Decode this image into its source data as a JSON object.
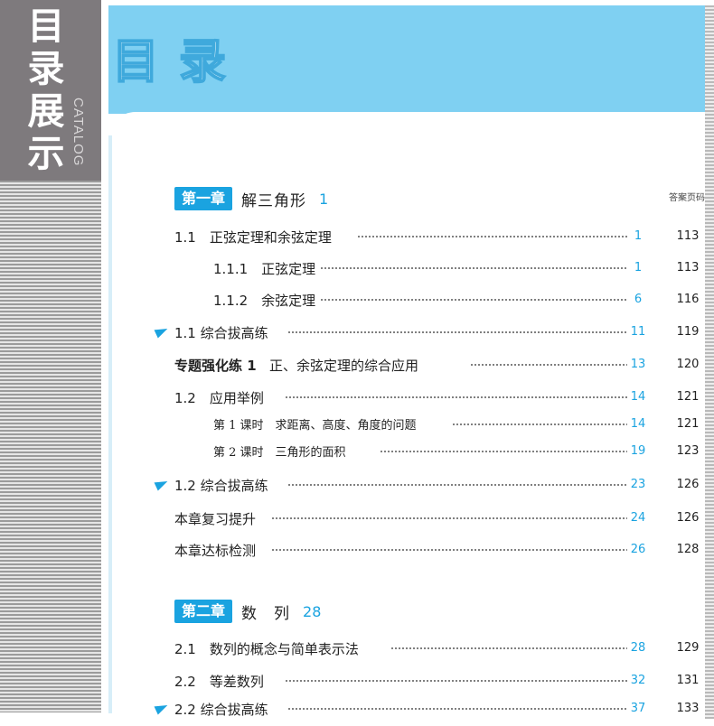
{
  "side_banner": {
    "title": "目录展示",
    "subtitle": "CATALOG"
  },
  "page_title": "目录",
  "answer_header": "答案页码",
  "chapters": [
    {
      "badge": "第一章",
      "title": "解三角形",
      "page": "1"
    },
    {
      "badge": "第二章",
      "title": "数　列",
      "page": "28"
    }
  ],
  "rows": [
    {
      "label": "1.1　正弦定理和余弦定理",
      "page": "1",
      "answer": "113"
    },
    {
      "label": "1.1.1　正弦定理",
      "page": "1",
      "answer": "113"
    },
    {
      "label": "1.1.2　余弦定理",
      "page": "6",
      "answer": "116"
    },
    {
      "label": "1.1 综合拔高练",
      "page": "11",
      "answer": "119"
    },
    {
      "label_bold": "专题强化练 1",
      "label": "正、余弦定理的综合应用",
      "page": "13",
      "answer": "120"
    },
    {
      "label": "1.2　应用举例",
      "page": "14",
      "answer": "121"
    },
    {
      "label": "第 1 课时　求距离、高度、角度的问题",
      "page": "14",
      "answer": "121"
    },
    {
      "label": "第 2 课时　三角形的面积",
      "page": "19",
      "answer": "123"
    },
    {
      "label": "1.2 综合拔高练",
      "page": "23",
      "answer": "126"
    },
    {
      "label": "本章复习提升",
      "page": "24",
      "answer": "126"
    },
    {
      "label": "本章达标检测",
      "page": "26",
      "answer": "128"
    },
    {
      "label": "2.1　数列的概念与简单表示法",
      "page": "28",
      "answer": "129"
    },
    {
      "label": "2.2　等差数列",
      "page": "32",
      "answer": "131"
    },
    {
      "label": "2.2 综合拔高练",
      "page": "37",
      "answer": "133"
    }
  ]
}
